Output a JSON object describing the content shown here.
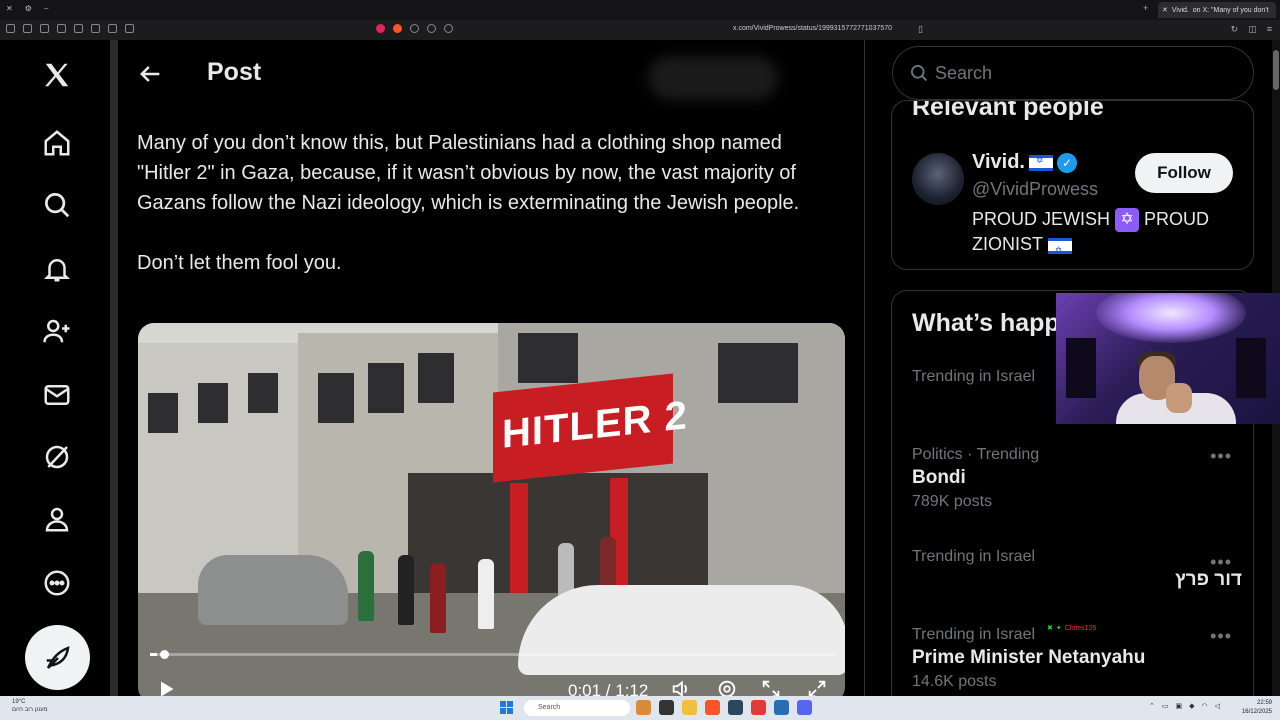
{
  "browser": {
    "tab_title": "Vivid.  on X: \"Many of you don't",
    "url": "x.com/VividProwess/status/1999315772771037570"
  },
  "post_header": {
    "title": "Post"
  },
  "tweet": {
    "paragraph1": "Many of you don’t know this, but Palestinians had a clothing shop named \"Hitler 2\" in Gaza, because, if it wasn’t obvious by now, the vast majority of Gazans follow the Nazi ideology, which is exterminating the Jewish people.",
    "paragraph2": "Don’t let them fool you."
  },
  "video": {
    "sign_text": "HITLER 2",
    "time": "0:01 / 1:12",
    "progress_fraction": 0.01
  },
  "search": {
    "placeholder": "Search"
  },
  "relevant_people": {
    "title": "Relevant people",
    "name": "Vivid.",
    "handle": "@VividProwess",
    "bio_part1": "PROUD JEWISH",
    "bio_part2": "PROUD ZIONIST",
    "follow_label": "Follow"
  },
  "whats_happening": {
    "title": "What’s happening",
    "trends": [
      {
        "meta": "Trending in Israel",
        "name": "",
        "count": ""
      },
      {
        "meta": "Politics · Trending",
        "name": "Bondi",
        "count": "789K posts"
      },
      {
        "meta": "Trending in Israel",
        "name": "דור פרץ",
        "count": ""
      },
      {
        "meta": "Trending in Israel",
        "name": "Prime Minister Netanyahu",
        "count": "14.6K posts"
      }
    ]
  },
  "chat_overlay": {
    "username": "Chites126"
  },
  "taskbar": {
    "search_placeholder": "Search",
    "weather_temp": "19°C",
    "weather_desc": "מעונן רוב היום",
    "time": "22:59",
    "date": "16/12/2025"
  },
  "colors": {
    "accent_blue": "#1d9bf0",
    "sign_red": "#c81e23",
    "background": "#000000"
  }
}
